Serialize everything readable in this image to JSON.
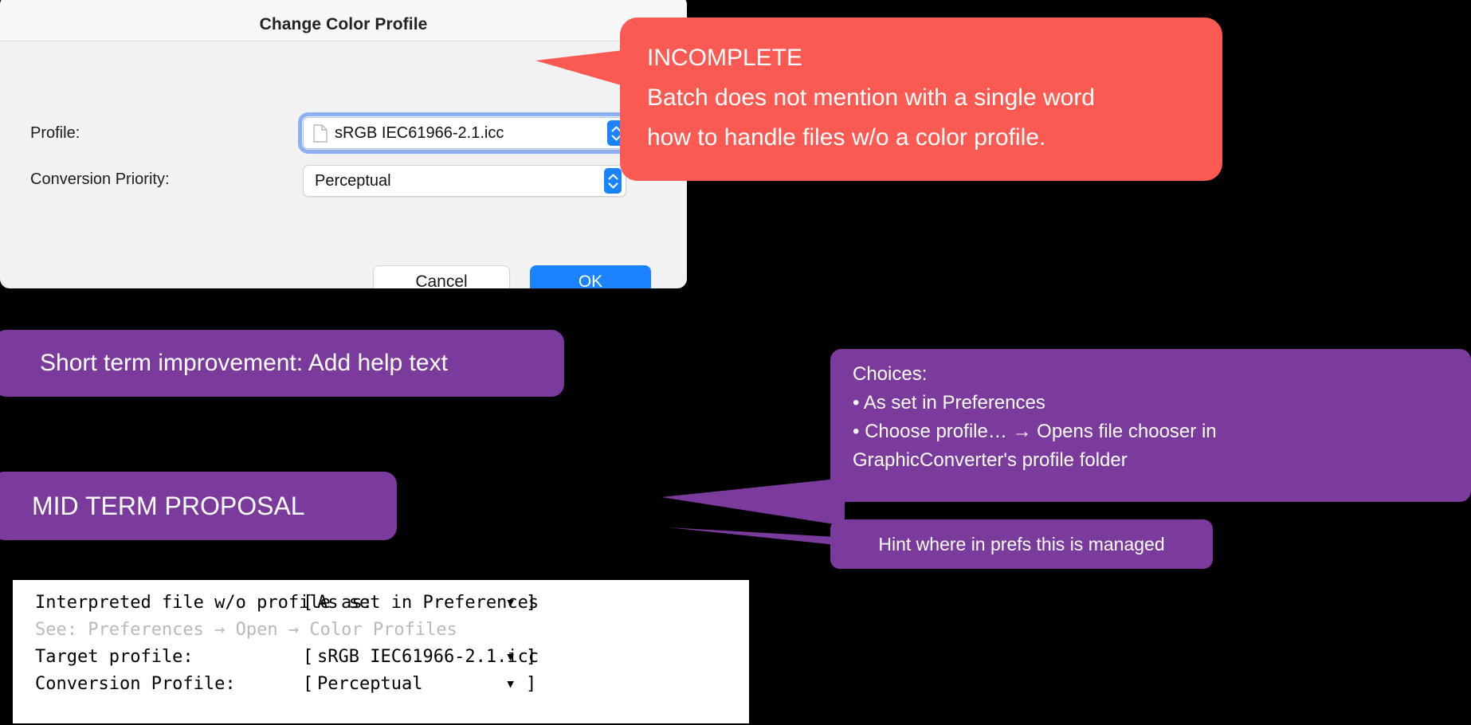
{
  "dialog": {
    "title": "Change Color Profile",
    "fields": [
      {
        "label": "Profile:",
        "value": "sRGB IEC61966-2.1.icc",
        "icon": "document-icon",
        "focused": true
      },
      {
        "label": "Conversion Priority:",
        "value": "Perceptual",
        "icon": "",
        "focused": false
      }
    ],
    "cancel_label": "Cancel",
    "ok_label": "OK",
    "accent_color": "#1b83ff"
  },
  "annotations": {
    "red_callout": {
      "color": "#fb5a52",
      "lines": [
        "INCOMPLETE",
        "Batch does not mention with a single word",
        "how to handle files w/o a color profile."
      ]
    },
    "purple_color": "#7b3b9c",
    "short_term": "Short term improvement: Add help text",
    "mid_term": "MID TERM PROPOSAL",
    "choices": {
      "lines": [
        "Choices:",
        "• As set in Preferences",
        "• Choose profile… → Opens file chooser in",
        "GraphicConverter's profile folder"
      ]
    },
    "hint": "Hint where in prefs this is managed"
  },
  "mockup": {
    "rows": [
      {
        "label": "Interpreted file w/o profile as:",
        "bracket_open": "[",
        "value": "As set in Preferences",
        "caret": "▾",
        "bracket_close": "]"
      },
      {
        "label": "Target profile:",
        "bracket_open": "[",
        "value": "sRGB IEC61966-2.1.icc",
        "caret": "▾",
        "bracket_close": "]"
      },
      {
        "label": "Conversion Profile:",
        "bracket_open": "[",
        "value": "Perceptual",
        "caret": "▾",
        "bracket_close": "]"
      }
    ],
    "hint_line": "See: Preferences → Open → Color Profiles"
  }
}
